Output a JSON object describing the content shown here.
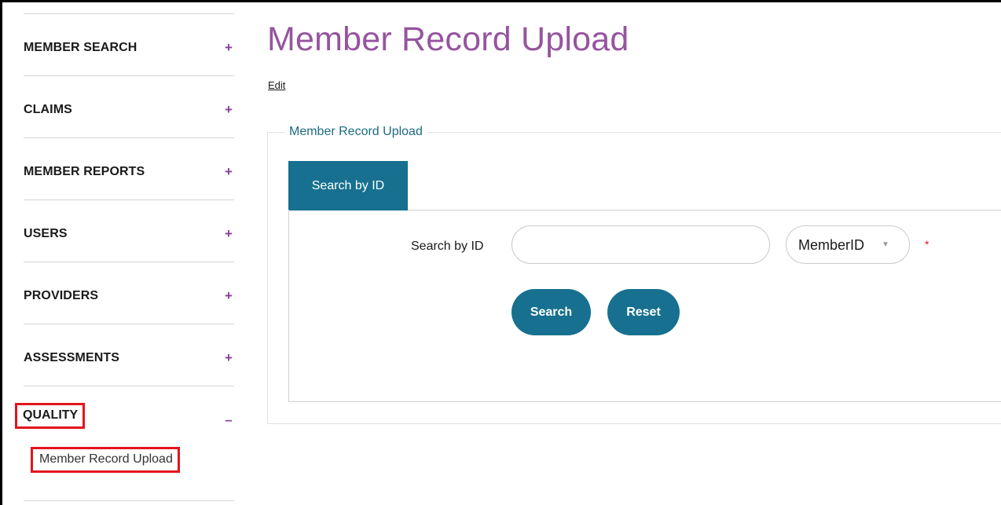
{
  "sidebar": {
    "items": [
      {
        "label": "MEMBER SEARCH",
        "toggle": "+"
      },
      {
        "label": "CLAIMS",
        "toggle": "+"
      },
      {
        "label": "MEMBER REPORTS",
        "toggle": "+"
      },
      {
        "label": "USERS",
        "toggle": "+"
      },
      {
        "label": "PROVIDERS",
        "toggle": "+"
      },
      {
        "label": "ASSESSMENTS",
        "toggle": "+"
      },
      {
        "label": "QUALITY",
        "toggle": "–"
      }
    ],
    "sub_items": [
      {
        "label": "Member Record Upload"
      }
    ]
  },
  "main": {
    "title": "Member Record Upload",
    "edit_label": "Edit",
    "section_legend": "Member Record Upload",
    "tabs": [
      {
        "label": "Search by ID",
        "active": true
      }
    ],
    "form": {
      "field_label": "Search by ID",
      "search_value": "",
      "search_placeholder": "",
      "select_value": "MemberID",
      "required_marker": "*",
      "search_button": "Search",
      "reset_button": "Reset"
    }
  },
  "colors": {
    "title_purple": "#96549f",
    "teal": "#17708f",
    "highlight_red": "#e3141b"
  }
}
